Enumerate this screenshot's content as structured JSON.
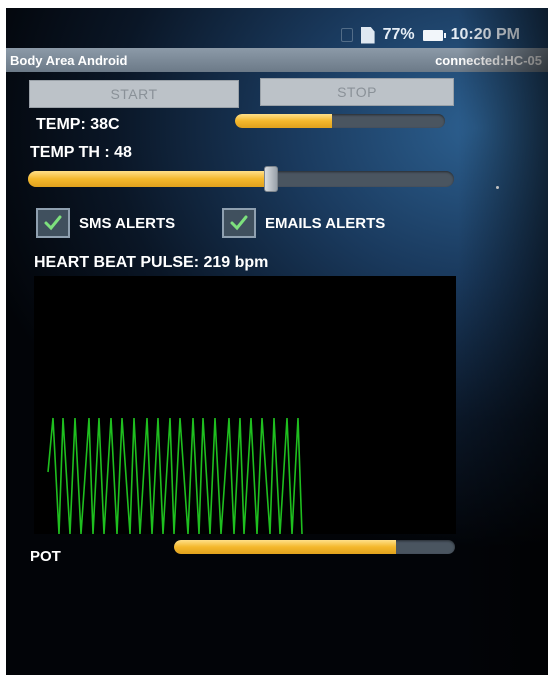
{
  "status_bar": {
    "battery_percent": "77%",
    "time": "10:20 PM",
    "icons": [
      "sim-icon",
      "document-icon",
      "battery-icon"
    ]
  },
  "title_bar": {
    "app_title": "Body Area Android",
    "connection_status": "connected:HC-05"
  },
  "buttons": {
    "start_label": "START",
    "stop_label": "STOP"
  },
  "temperature": {
    "label": "TEMP: 38C",
    "bar_level": 0.46
  },
  "threshold": {
    "label": "TEMP TH : 48",
    "slider_level": 0.57
  },
  "alerts": {
    "sms_label": "SMS ALERTS",
    "sms_checked": true,
    "email_label": "EMAILS ALERTS",
    "email_checked": true
  },
  "heart_beat": {
    "label": "HEART BEAT PULSE: 219 bpm"
  },
  "pot": {
    "label": "POT",
    "bar_level": 0.79
  },
  "colors": {
    "accent_yellow": "#f4b82c",
    "waveform_green": "#1fbf1f",
    "check_green": "#7de07d",
    "title_bar_gray": "#7c8a98"
  }
}
